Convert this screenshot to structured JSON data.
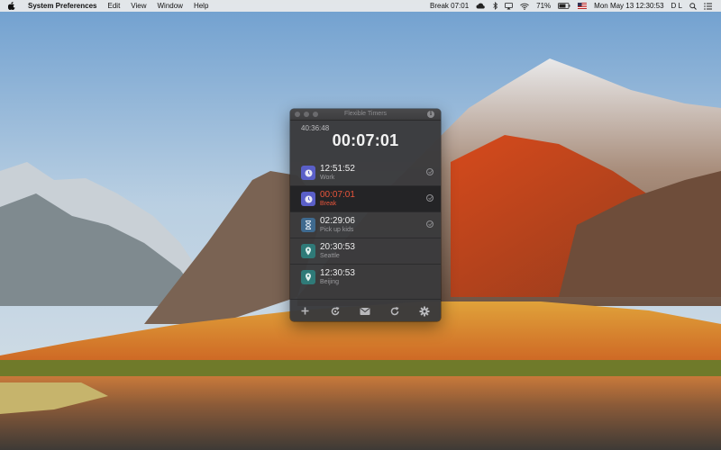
{
  "menubar": {
    "app_name": "System Preferences",
    "menus": [
      "Edit",
      "View",
      "Window",
      "Help"
    ],
    "status_timer": "Break 07:01",
    "battery": "71%",
    "clock": "Mon May 13  12:30:53",
    "user": "D L"
  },
  "widget": {
    "title": "Flexible Timers",
    "elapsed": "40:36:48",
    "current_timer": "00:07:01",
    "items": [
      {
        "time": "12:51:52",
        "label": "Work",
        "icon": "clock-icon",
        "icon_color": "#5a5fc8",
        "checkable": true,
        "active": false
      },
      {
        "time": "00:07:01",
        "label": "Break",
        "icon": "clock-icon",
        "icon_color": "#5a5fc8",
        "checkable": true,
        "active": true
      },
      {
        "time": "02:29:06",
        "label": "Pick up kids",
        "icon": "hourglass-icon",
        "icon_color": "#3f6a8f",
        "checkable": true,
        "active": false
      },
      {
        "time": "20:30:53",
        "label": "Seattle",
        "icon": "location-pin-icon",
        "icon_color": "#2f7a78",
        "checkable": false,
        "active": false
      },
      {
        "time": "12:30:53",
        "label": "Beijing",
        "icon": "location-pin-icon",
        "icon_color": "#2f7a78",
        "checkable": false,
        "active": false
      }
    ],
    "toolbar": [
      "add-icon",
      "reset-all-icon",
      "mail-icon",
      "restart-icon",
      "settings-icon"
    ],
    "accent_color": "#e8553b"
  }
}
